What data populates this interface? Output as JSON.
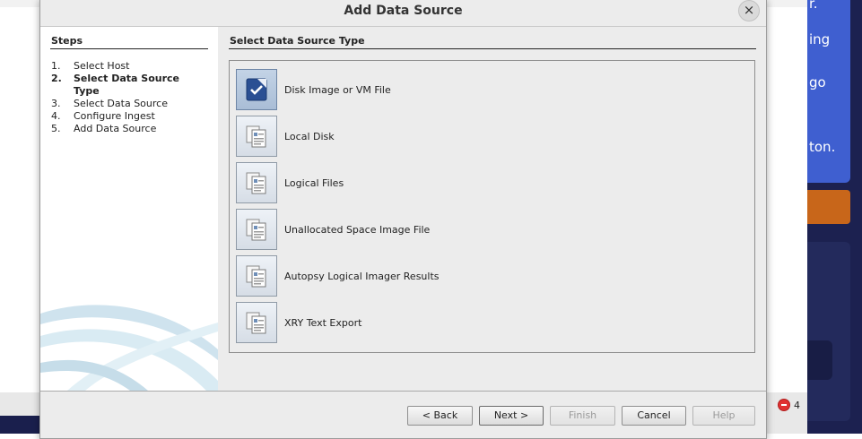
{
  "dialog": {
    "title": "Add Data Source",
    "close_glyph": "×"
  },
  "steps": {
    "heading": "Steps",
    "items": [
      {
        "num": "1.",
        "label": "Select Host",
        "active": false
      },
      {
        "num": "2.",
        "label": "Select Data Source Type",
        "active": true
      },
      {
        "num": "3.",
        "label": "Select Data Source",
        "active": false
      },
      {
        "num": "4.",
        "label": "Configure Ingest",
        "active": false
      },
      {
        "num": "5.",
        "label": "Add Data Source",
        "active": false
      }
    ]
  },
  "content": {
    "heading": "Select Data Source Type",
    "types": [
      {
        "label": "Disk Image or VM File",
        "selected": true,
        "icon": "disk-image-icon"
      },
      {
        "label": "Local Disk",
        "selected": false,
        "icon": "document-icon"
      },
      {
        "label": "Logical Files",
        "selected": false,
        "icon": "document-icon"
      },
      {
        "label": "Unallocated Space Image File",
        "selected": false,
        "icon": "document-icon"
      },
      {
        "label": "Autopsy Logical Imager Results",
        "selected": false,
        "icon": "document-icon"
      },
      {
        "label": "XRY Text Export",
        "selected": false,
        "icon": "document-icon"
      }
    ]
  },
  "footer": {
    "back_label": "< Back",
    "next_label": "Next >",
    "finish_label": "Finish",
    "cancel_label": "Cancel",
    "help_label": "Help"
  },
  "background_app": {
    "right_text_fragments": [
      "ing",
      "go",
      "ton."
    ],
    "error_count": "4"
  },
  "colors": {
    "dialog_bg": "#ececec",
    "selected_tile": "#b6c8de",
    "right_app_blue": "#3f5fd0",
    "right_app_orange": "#c8661a",
    "right_app_navy": "#1c2150",
    "error_red": "#e03030"
  }
}
